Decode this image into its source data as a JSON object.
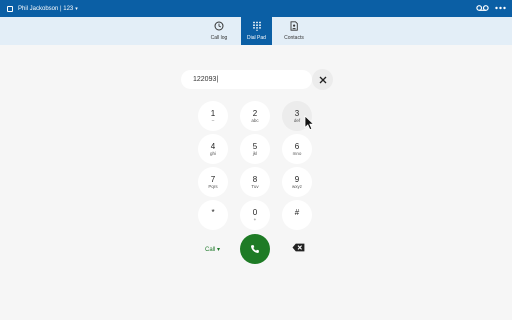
{
  "header": {
    "user_name": "Phil Jackobson | 123",
    "caret": "▾"
  },
  "tabs": [
    {
      "label": "Call log",
      "icon": "clock-icon",
      "active": false
    },
    {
      "label": "Dial Pad",
      "icon": "dialpad-icon",
      "active": true
    },
    {
      "label": "Contacts",
      "icon": "contacts-icon",
      "active": false
    }
  ],
  "dialer": {
    "number": "122093|",
    "keys": [
      {
        "digit": "1",
        "letters": "–"
      },
      {
        "digit": "2",
        "letters": "abc"
      },
      {
        "digit": "3",
        "letters": "def"
      },
      {
        "digit": "4",
        "letters": "ghi"
      },
      {
        "digit": "5",
        "letters": "jkl"
      },
      {
        "digit": "6",
        "letters": "mno"
      },
      {
        "digit": "7",
        "letters": "Pqrs"
      },
      {
        "digit": "8",
        "letters": "Tuv"
      },
      {
        "digit": "9",
        "letters": "wxyz"
      },
      {
        "digit": "*",
        "letters": ""
      },
      {
        "digit": "0",
        "letters": "+"
      },
      {
        "digit": "#",
        "letters": ""
      }
    ],
    "call_type_label": "Call ▾"
  },
  "colors": {
    "top_bar": "#0b5fa5",
    "tab_bar": "#e3eef7",
    "call_green": "#1e7b25"
  }
}
